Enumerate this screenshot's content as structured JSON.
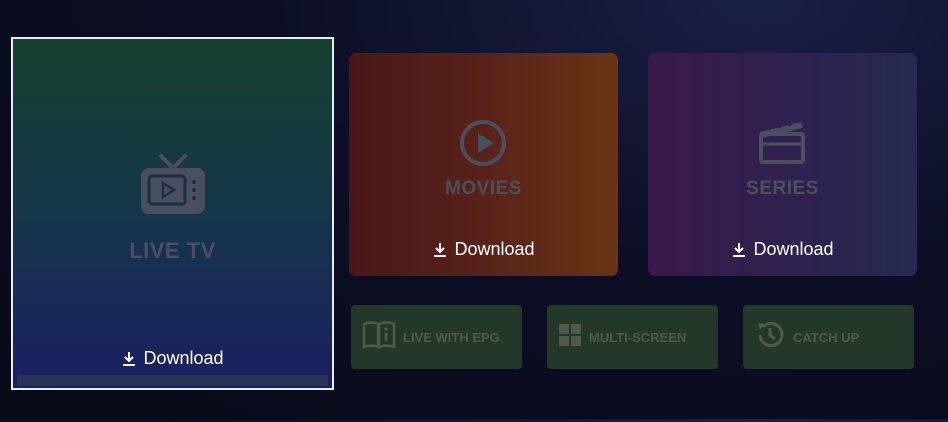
{
  "tiles": {
    "live_tv": {
      "title": "LIVE TV",
      "action": "Download",
      "icon": "tv-icon"
    },
    "movies": {
      "title": "MOVIES",
      "action": "Download",
      "icon": "play-circle-icon"
    },
    "series": {
      "title": "SERIES",
      "action": "Download",
      "icon": "clapperboard-icon"
    }
  },
  "shortcuts": [
    {
      "label": "LIVE WITH EPG",
      "icon": "epg-book-icon"
    },
    {
      "label": "MULTI-SCREEN",
      "icon": "grid-icon"
    },
    {
      "label": "CATCH UP",
      "icon": "history-icon"
    }
  ],
  "colors": {
    "focus_border": "#e9ecf3",
    "shortcut_bg": "#243829",
    "dim_text": "#4c505e"
  }
}
